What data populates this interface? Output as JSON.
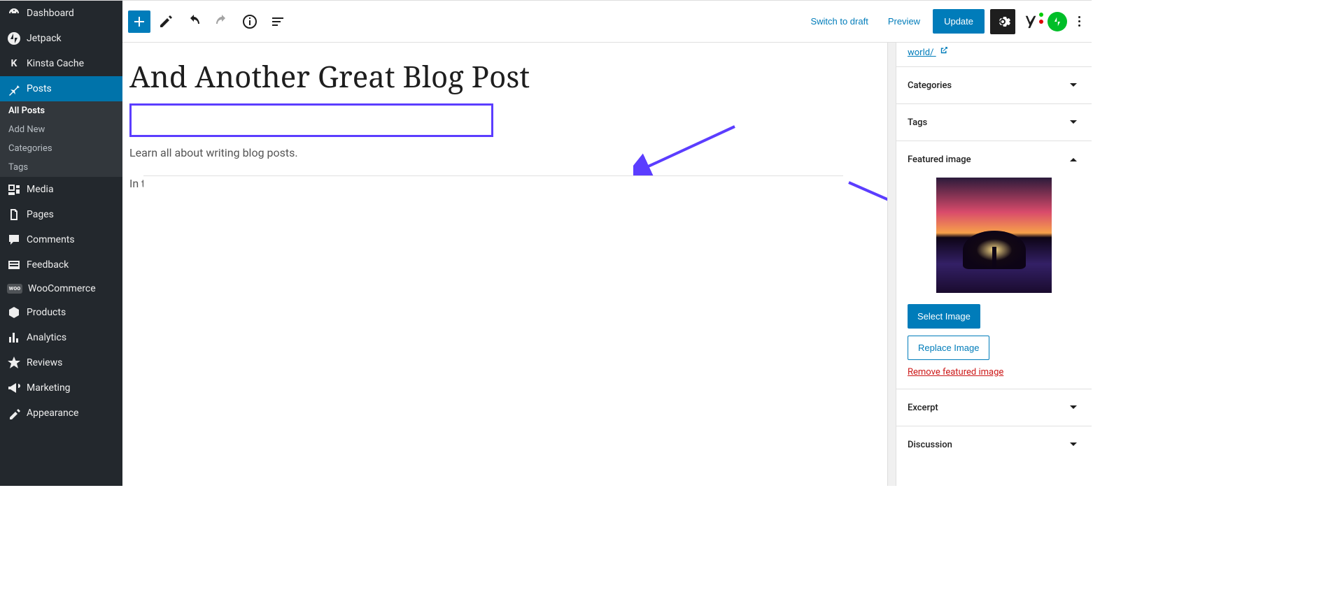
{
  "sidebar": {
    "items": [
      {
        "label": "Dashboard",
        "icon": "dashboard"
      },
      {
        "label": "Jetpack",
        "icon": "jetpack"
      },
      {
        "label": "Kinsta Cache",
        "icon": "kinsta"
      },
      {
        "label": "Posts",
        "icon": "pin",
        "active": true
      },
      {
        "label": "Media",
        "icon": "media"
      },
      {
        "label": "Pages",
        "icon": "pages"
      },
      {
        "label": "Comments",
        "icon": "comments"
      },
      {
        "label": "Feedback",
        "icon": "feedback"
      },
      {
        "label": "WooCommerce",
        "icon": "woo"
      },
      {
        "label": "Products",
        "icon": "products"
      },
      {
        "label": "Analytics",
        "icon": "analytics"
      },
      {
        "label": "Reviews",
        "icon": "star"
      },
      {
        "label": "Marketing",
        "icon": "megaphone"
      },
      {
        "label": "Appearance",
        "icon": "appearance"
      }
    ],
    "submenu": [
      "All Posts",
      "Add New",
      "Categories",
      "Tags"
    ]
  },
  "topbar": {
    "switch_draft": "Switch to draft",
    "preview": "Preview",
    "update": "Update"
  },
  "editor": {
    "title": "And Another Great Blog Post",
    "para1": "Learn all about writing blog posts.",
    "para2": "In this area we can write content and make a nice article."
  },
  "panel": {
    "permalink_suffix": "world/",
    "sections": {
      "categories": "Categories",
      "tags": "Tags",
      "featured": "Featured image",
      "excerpt": "Excerpt",
      "discussion": "Discussion"
    },
    "featured": {
      "select": "Select Image",
      "replace": "Replace Image",
      "remove": "Remove featured image"
    }
  },
  "annotation": {
    "color": "#5b3dff"
  }
}
